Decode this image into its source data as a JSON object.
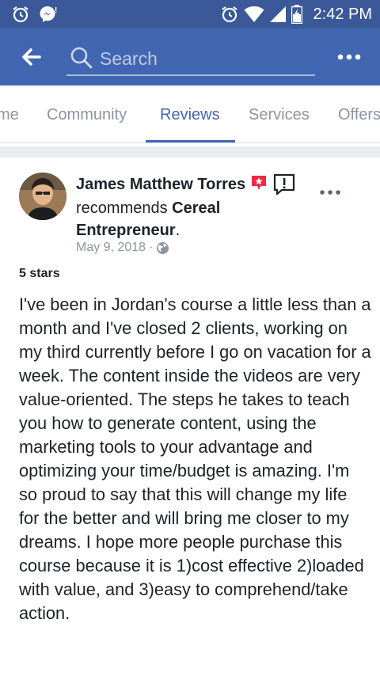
{
  "status_bar": {
    "time": "2:42 PM",
    "icons": [
      "alarm-icon",
      "messenger-notification-icon",
      "alarm-icon",
      "wifi-icon",
      "cell-signal-icon",
      "battery-charging-icon"
    ]
  },
  "app_bar": {
    "search_placeholder": "Search",
    "icons": [
      "back-arrow-icon",
      "search-icon",
      "more-options-icon"
    ]
  },
  "tabs": [
    {
      "label": "me",
      "active": false
    },
    {
      "label": "Community",
      "active": false
    },
    {
      "label": "Reviews",
      "active": true
    },
    {
      "label": "Services",
      "active": false
    },
    {
      "label": "Offers",
      "active": false
    }
  ],
  "colors": {
    "status_bar": "#3b5998",
    "app_bar": "#4267b2",
    "accent": "#4267b2",
    "inactive_tab": "#8d949e",
    "text": "#1d2129",
    "meta": "#90949c",
    "divider": "#e9ebee"
  },
  "review": {
    "author": "James Matthew Torres",
    "recommends_text": "recommends",
    "page_name": "Cereal Entrepreneur",
    "page_suffix": ".",
    "date": "May 9, 2018",
    "date_separator": "·",
    "rating": "5 stars",
    "body": "I've been in Jordan's course a little less than a month and I've closed 2 clients, working on my third currently before I go on vacation for a week. The content inside the videos are very value-oriented. The steps he takes to teach you how to generate content, using the marketing tools to your advantage and optimizing your time/budget is amazing. I'm so proud to say that this will change my life for the better and will bring me closer to my dreams.  I hope more people purchase this course because it is 1)cost effective 2)loaded with value, and 3)easy to comprehend/take action."
  }
}
